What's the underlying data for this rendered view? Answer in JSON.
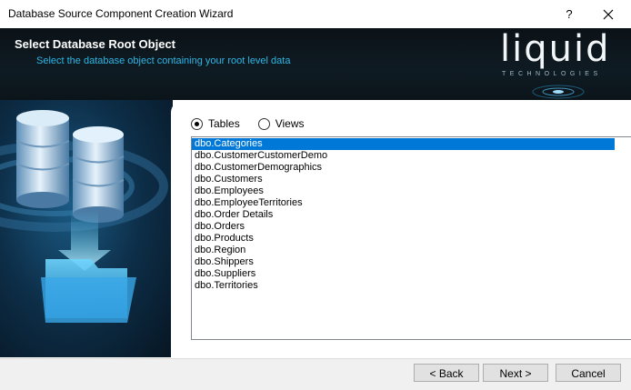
{
  "window": {
    "title": "Database Source Component Creation Wizard",
    "help_glyph": "?"
  },
  "banner": {
    "heading": "Select Database Root Object",
    "subheading": "Select the database object containing your root level data",
    "logo_word": "liquid",
    "logo_tagline": "TECHNOLOGIES"
  },
  "object_type": {
    "options": [
      {
        "label": "Tables",
        "selected": true
      },
      {
        "label": "Views",
        "selected": false
      }
    ]
  },
  "objects": {
    "items": [
      "dbo.Categories",
      "dbo.CustomerCustomerDemo",
      "dbo.CustomerDemographics",
      "dbo.Customers",
      "dbo.Employees",
      "dbo.EmployeeTerritories",
      "dbo.Order Details",
      "dbo.Orders",
      "dbo.Products",
      "dbo.Region",
      "dbo.Shippers",
      "dbo.Suppliers",
      "dbo.Territories"
    ],
    "selected_index": 0
  },
  "buttons": {
    "back": "< Back",
    "next": "Next >",
    "cancel": "Cancel"
  },
  "colors": {
    "accent": "#2fb6e6",
    "selection": "#0078d7",
    "banner_bg": "#0b1217"
  }
}
